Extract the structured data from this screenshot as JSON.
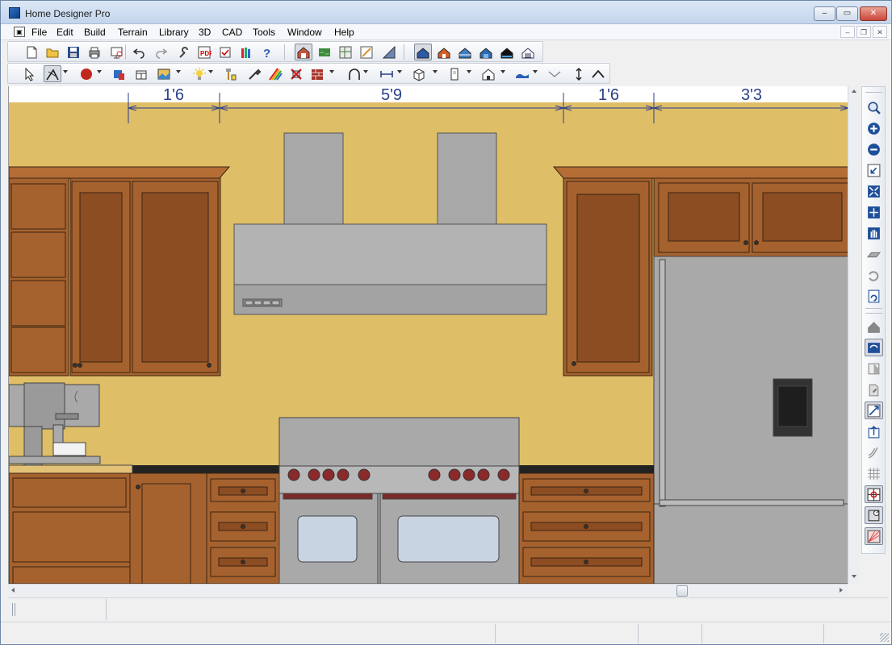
{
  "window": {
    "title": "Home Designer Pro",
    "minimize_glyph": "–",
    "maximize_glyph": "▭",
    "close_glyph": "✕"
  },
  "menu": {
    "items": [
      "File",
      "Edit",
      "Build",
      "Terrain",
      "Library",
      "3D",
      "CAD",
      "Tools",
      "Window",
      "Help"
    ],
    "mdi_minimize": "–",
    "mdi_restore": "❐",
    "mdi_close": "✕"
  },
  "toolbar1": {
    "icons": [
      "new-icon",
      "open-icon",
      "save-icon",
      "print-icon",
      "print-preview-icon",
      "undo-icon",
      "redo-icon",
      "wrench-icon",
      "layout-pdf-icon",
      "checklist-icon",
      "library-books-icon",
      "help-icon",
      "floor-plan-view-icon",
      "elevation-view-icon",
      "cross-section-icon",
      "plan-sheet-icon",
      "cad-detail-icon",
      "camera-view-icon",
      "full-overview-icon",
      "doll-house-icon",
      "perspective-icon",
      "glass-house-icon",
      "framing-icon"
    ]
  },
  "toolbar2": {
    "icons": [
      "select-arrow-icon",
      "edit-tool-icon",
      "color-circle-icon",
      "fill-icon",
      "cabinet-icon",
      "picture-icon",
      "light-bulb-icon",
      "paint-brush-icon",
      "eyedropper-icon",
      "rainbow-icon",
      "no-material-icon",
      "wall-brick-icon",
      "arc-icon",
      "dimension-icon",
      "3d-box-icon",
      "door-icon",
      "house-icon",
      "terrain-icon",
      "check-icon",
      "arrow-up-down-icon",
      "caret-up-icon"
    ]
  },
  "right_toolbar": {
    "icons": [
      "zoom-icon",
      "zoom-in-icon",
      "zoom-out-icon",
      "undo-zoom-icon",
      "fill-window-icon",
      "fill-window-all-icon",
      "pan-hand-icon",
      "floor-up-icon",
      "floor-down-icon",
      "refresh-view-icon",
      "roof-icon",
      "rebuild-walls-icon",
      "layer-icon",
      "material-icon",
      "dimension-tool-icon",
      "point-icon",
      "curve-icon",
      "grid-icon",
      "snap-icon",
      "angle-snap-icon",
      "reference-icon"
    ]
  },
  "drawing": {
    "dimensions": [
      "1'6",
      "5'9",
      "1'6",
      "3'3"
    ],
    "colors": {
      "wall": "#dfbe68",
      "cabinet": "#a5622f",
      "cabinet_panel": "#8c4d23",
      "stainless": "#a9a9a9",
      "stainless_dark": "#888888",
      "countertop": "#222222",
      "dimension": "#2a3f8a"
    }
  },
  "statusbar": {}
}
